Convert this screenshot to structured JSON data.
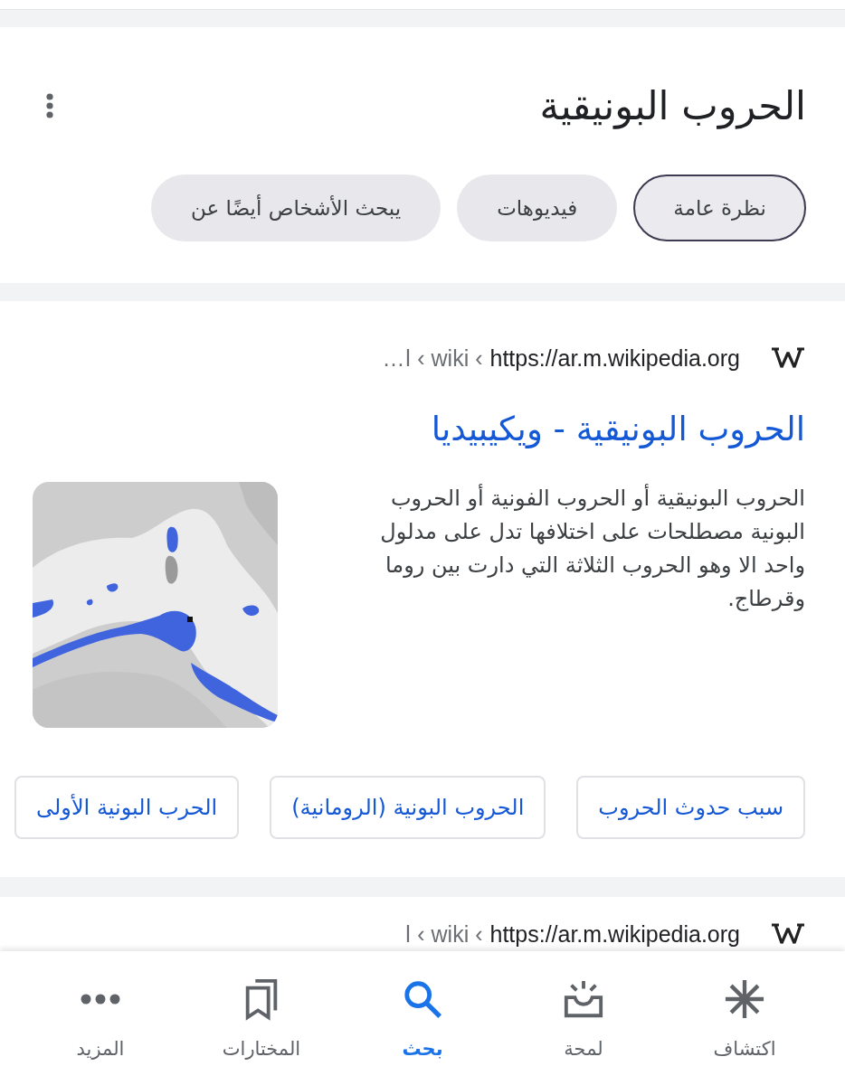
{
  "header": {
    "title": "الحروب البونيقية",
    "tabs": [
      {
        "label": "نظرة عامة",
        "selected": true
      },
      {
        "label": "فيديوهات",
        "selected": false
      },
      {
        "label": "يبحث الأشخاص أيضًا عن",
        "selected": false
      }
    ]
  },
  "results": [
    {
      "url": "https://ar.m.wikipedia.org",
      "breadcrumb": "…ا ‹ wiki ‹",
      "title": "الحروب البونيقية - ويكيبيديا",
      "snippet": "الحروب البونيقية أو الحروب الفونية أو الحروب البونية مصطلحات على اختلافها تدل على مدلول واحد الا وهو الحروب الثلاثة التي دارت بين روما وقرطاج.",
      "related": [
        "سبب حدوث الحروب",
        "الحروب البونية (الرومانية)",
        "الحرب البونية الأولى"
      ]
    },
    {
      "url": "https://ar.m.wikipedia.org",
      "breadcrumb": "ا ‹ wiki ‹"
    }
  ],
  "bottom_nav": [
    {
      "label": "اكتشاف",
      "selected": false
    },
    {
      "label": "لمحة",
      "selected": false
    },
    {
      "label": "بحث",
      "selected": true
    },
    {
      "label": "المختارات",
      "selected": false
    },
    {
      "label": "المزيد",
      "selected": false
    }
  ]
}
